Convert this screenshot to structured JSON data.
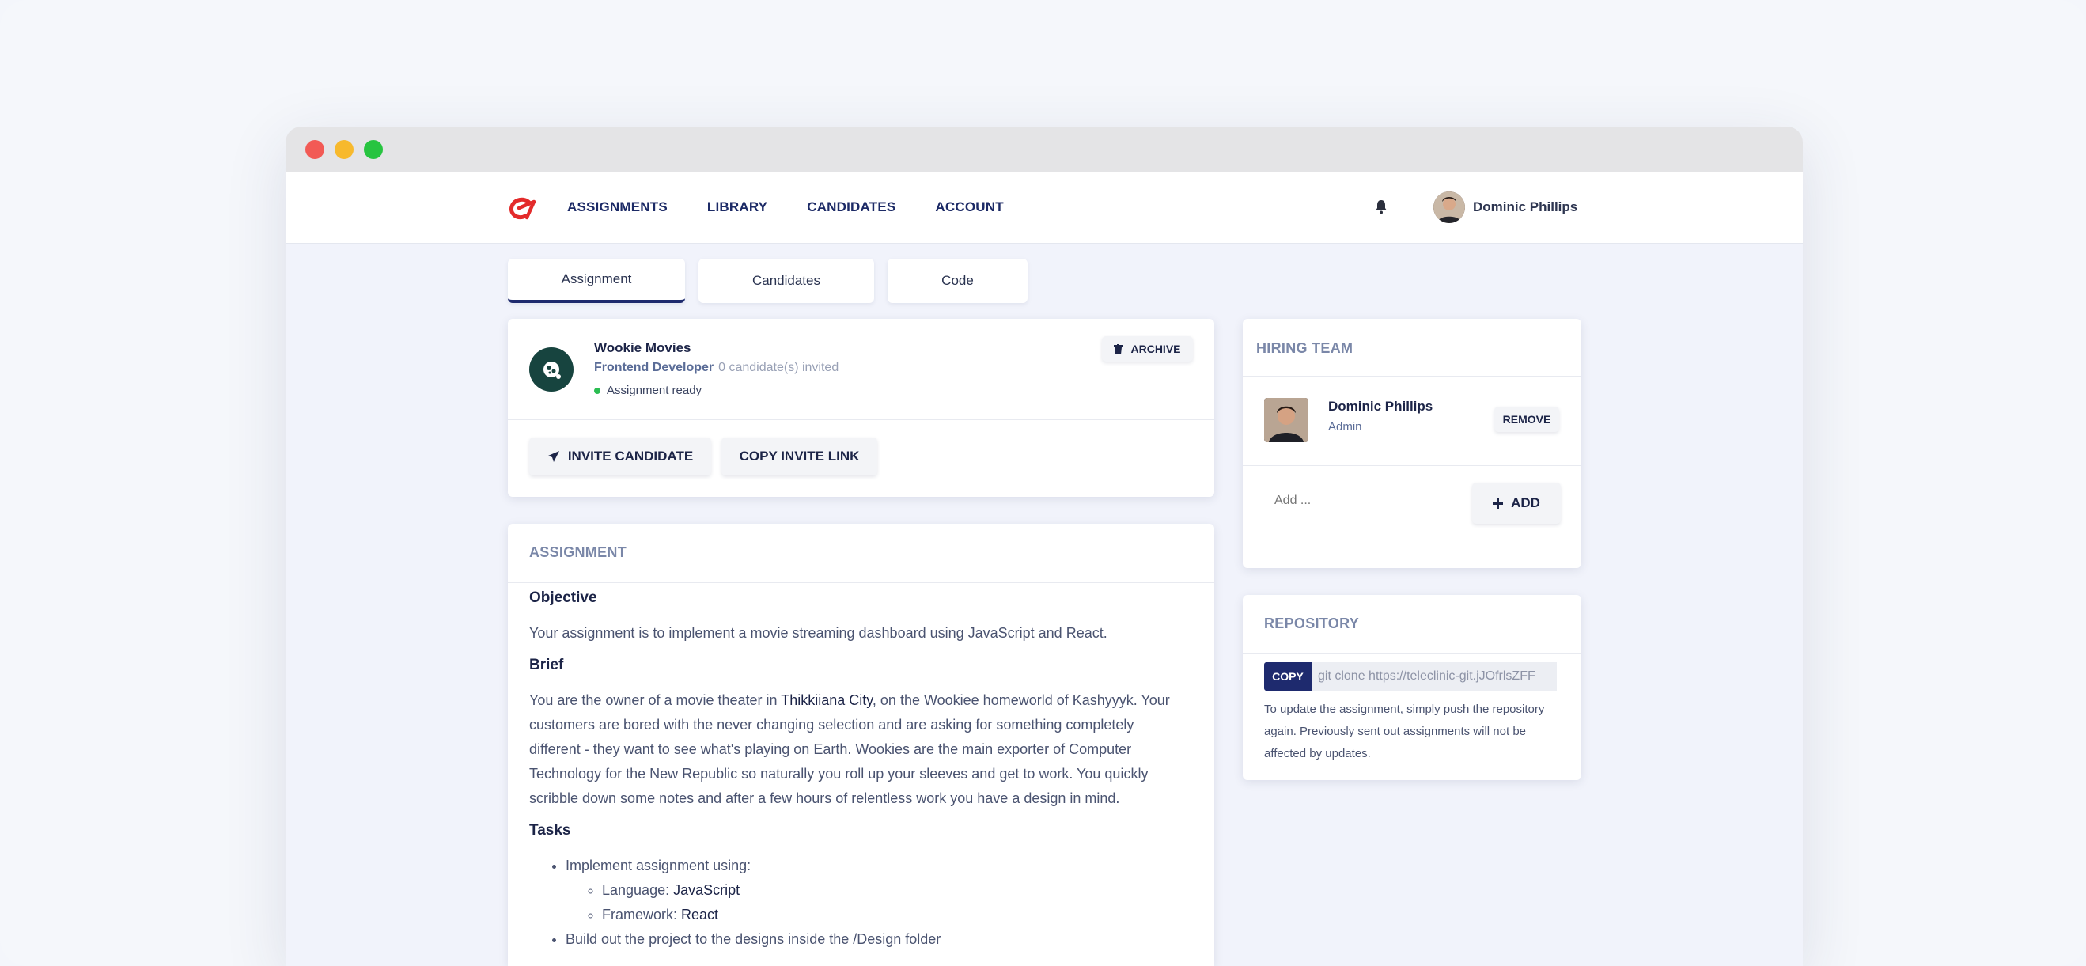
{
  "nav": {
    "links": [
      "ASSIGNMENTS",
      "LIBRARY",
      "CANDIDATES",
      "ACCOUNT"
    ],
    "user_name": "Dominic Phillips",
    "brand_color": "#e32b2b"
  },
  "tabs": [
    "Assignment",
    "Candidates",
    "Code"
  ],
  "summary": {
    "company": "Wookie Movies",
    "role": "Frontend Developer",
    "invited": "0 candidate(s) invited",
    "status": "Assignment ready",
    "archive_label": "ARCHIVE",
    "invite_label": "INVITE CANDIDATE",
    "copy_link_label": "COPY INVITE LINK"
  },
  "assignment": {
    "title": "ASSIGNMENT",
    "objective_heading": "Objective",
    "objective_text": "Your assignment is to implement a movie streaming dashboard using JavaScript and React.",
    "brief_heading": "Brief",
    "brief_1": "You are the owner of a movie theater in ",
    "brief_city": "Thikkiiana City",
    "brief_2": ", on the Wookiee homeworld of Kashyyyk. Your customers are bored with the never changing selection and are asking for something completely different - they want to see what's playing on Earth. Wookies are the main exporter of Computer Technology for the New Republic so naturally you roll up your sleeves and get to work. You quickly scribble down some notes and after a few hours of relentless work you have a design in mind.",
    "tasks_heading": "Tasks",
    "task_1": "Implement assignment using:",
    "language_label": "Language: ",
    "language_value": "JavaScript",
    "framework_label": "Framework: ",
    "framework_value": "React",
    "task_2": "Build out the project to the designs inside the /Design folder"
  },
  "hiring": {
    "title": "HIRING TEAM",
    "member_name": "Dominic Phillips",
    "member_role": "Admin",
    "remove_label": "REMOVE",
    "add_placeholder": "Add ...",
    "add_label": "ADD"
  },
  "repo": {
    "title": "REPOSITORY",
    "copy_label": "COPY",
    "clone_value": "git clone https://teleclinic-git.jJOfrlsZFF",
    "note": "To update the assignment, simply push the repository again. Previously sent out assignments will not be affected by updates."
  }
}
